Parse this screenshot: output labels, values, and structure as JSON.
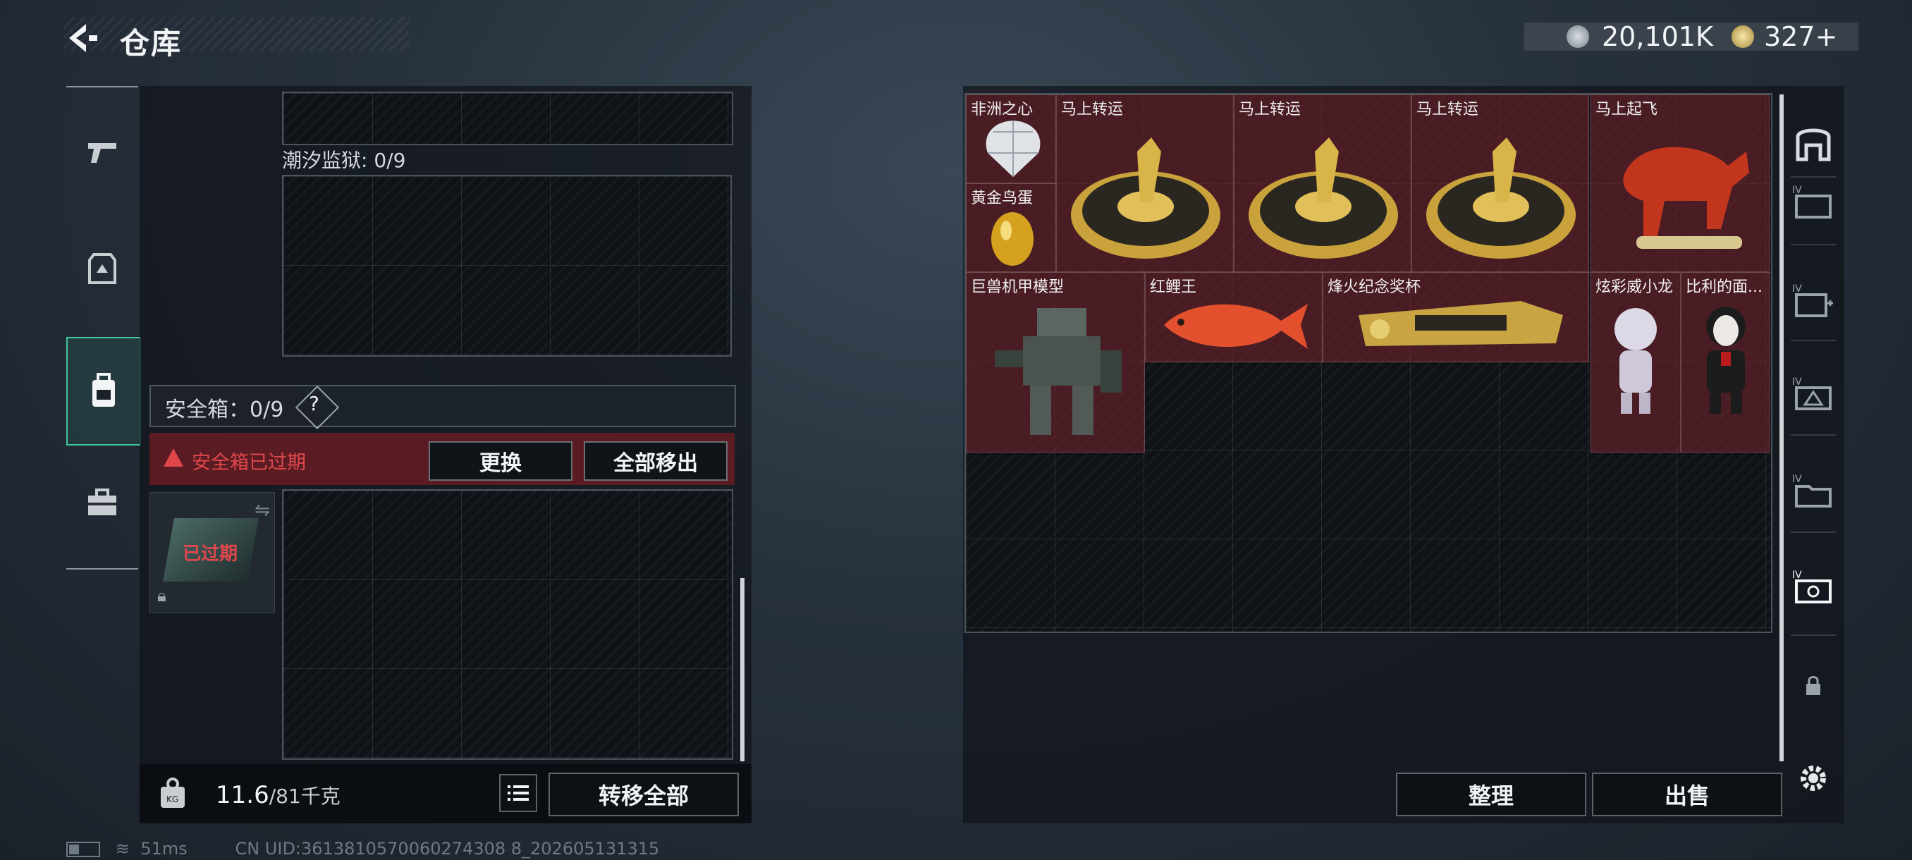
{
  "header": {
    "title": "仓库"
  },
  "currency": {
    "primary": "20,101K",
    "secondary": "327+"
  },
  "left_panel": {
    "prison_label": "潮汐监狱: 0/9",
    "safe_box_label": "安全箱：0/9",
    "safe_help": "?",
    "expired_warning": "安全箱已过期",
    "replace_button": "更换",
    "remove_all_button": "全部移出",
    "thumb_status": "已过期",
    "weight_value": "11.6",
    "weight_max": "/81千克",
    "transfer_all_button": "转移全部"
  },
  "right_panel": {
    "items": [
      {
        "name": "非洲之心"
      },
      {
        "name": "黄金鸟蛋"
      },
      {
        "name": "马上转运"
      },
      {
        "name": "马上转运"
      },
      {
        "name": "马上转运"
      },
      {
        "name": "马上起飞"
      },
      {
        "name": "巨兽机甲模型"
      },
      {
        "name": "红鲤王"
      },
      {
        "name": "烽火纪念奖杯"
      },
      {
        "name": "炫彩威小龙"
      },
      {
        "name": "比利的面..."
      }
    ],
    "sort_button": "整理",
    "sell_button": "出售"
  },
  "status_bar": {
    "ping": "51ms",
    "uid": "CN UID:3613810570060274308 8_202605131315"
  },
  "colors": {
    "accent": "#3fc99a",
    "warning": "#e0474c",
    "item_bg": "#6e222a"
  },
  "icons": [
    "back-icon",
    "coin-icon",
    "gem-icon",
    "gun-icon",
    "armor-icon",
    "backpack-icon",
    "toolbox-icon",
    "lock-icon",
    "list-icon",
    "gear-icon"
  ]
}
